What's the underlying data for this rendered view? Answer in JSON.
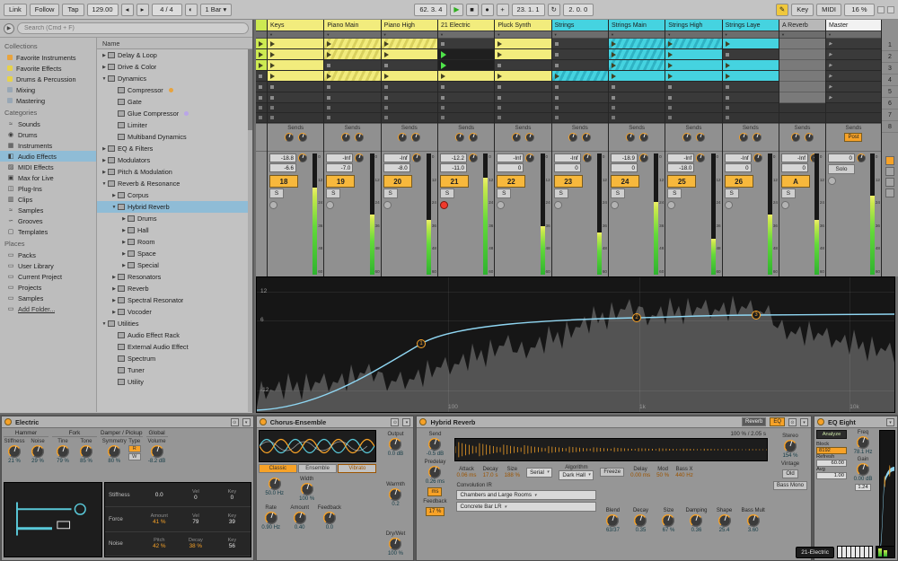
{
  "transport": {
    "link": "Link",
    "follow": "Follow",
    "tap": "Tap",
    "tempo": "129.00",
    "time_signature": "4 / 4",
    "quantization": "1 Bar",
    "arrangement_position": "62. 3. 4",
    "song_position": "23. 1. 1",
    "loop_length": "2. 0. 0",
    "key_button": "Key",
    "midi_button": "MIDI",
    "cpu_load": "16 %"
  },
  "browser": {
    "search_placeholder": "Search (Cmd + F)",
    "sections": {
      "collections": {
        "label": "Collections",
        "items": [
          {
            "label": "Favorite Instruments",
            "color": "#e8a33d"
          },
          {
            "label": "Favorite Effects",
            "color": "#e6d24b"
          },
          {
            "label": "Drums & Percussion",
            "color": "#e6d24b"
          },
          {
            "label": "Mixing",
            "color": "#98a7b5"
          },
          {
            "label": "Mastering",
            "color": "#98a7b5"
          }
        ]
      },
      "categories": {
        "label": "Categories",
        "items": [
          {
            "label": "Sounds",
            "icon": "waves"
          },
          {
            "label": "Drums",
            "icon": "drum"
          },
          {
            "label": "Instruments",
            "icon": "keys"
          },
          {
            "label": "Audio Effects",
            "icon": "fx",
            "selected": true
          },
          {
            "label": "MIDI Effects",
            "icon": "midi"
          },
          {
            "label": "Max for Live",
            "icon": "max"
          },
          {
            "label": "Plug-Ins",
            "icon": "plug"
          },
          {
            "label": "Clips",
            "icon": "clip"
          },
          {
            "label": "Samples",
            "icon": "sample"
          },
          {
            "label": "Grooves",
            "icon": "groove"
          },
          {
            "label": "Templates",
            "icon": "template"
          }
        ]
      },
      "places": {
        "label": "Places",
        "items": [
          {
            "label": "Packs"
          },
          {
            "label": "User Library"
          },
          {
            "label": "Current Project"
          },
          {
            "label": "Projects"
          },
          {
            "label": "Samples"
          },
          {
            "label": "Add Folder...",
            "underline": true
          }
        ]
      }
    },
    "tree_header": "Name",
    "tree": [
      {
        "label": "Delay & Loop",
        "depth": 0,
        "arrow": "right"
      },
      {
        "label": "Drive & Color",
        "depth": 0,
        "arrow": "right"
      },
      {
        "label": "Dynamics",
        "depth": 0,
        "arrow": "down"
      },
      {
        "label": "Compressor",
        "depth": 1,
        "arrow": "none",
        "dot": "#e8a33d"
      },
      {
        "label": "Gate",
        "depth": 1,
        "arrow": "none"
      },
      {
        "label": "Glue Compressor",
        "depth": 1,
        "arrow": "none",
        "dot": "#b9a5e8"
      },
      {
        "label": "Limiter",
        "depth": 1,
        "arrow": "none"
      },
      {
        "label": "Multiband Dynamics",
        "depth": 1,
        "arrow": "none"
      },
      {
        "label": "EQ & Filters",
        "depth": 0,
        "arrow": "right"
      },
      {
        "label": "Modulators",
        "depth": 0,
        "arrow": "right"
      },
      {
        "label": "Pitch & Modulation",
        "depth": 0,
        "arrow": "right"
      },
      {
        "label": "Reverb & Resonance",
        "depth": 0,
        "arrow": "down"
      },
      {
        "label": "Corpus",
        "depth": 1,
        "arrow": "right"
      },
      {
        "label": "Hybrid Reverb",
        "depth": 1,
        "arrow": "down",
        "selected": true
      },
      {
        "label": "Drums",
        "depth": 2,
        "arrow": "right"
      },
      {
        "label": "Hall",
        "depth": 2,
        "arrow": "right"
      },
      {
        "label": "Room",
        "depth": 2,
        "arrow": "right"
      },
      {
        "label": "Space",
        "depth": 2,
        "arrow": "right"
      },
      {
        "label": "Special",
        "depth": 2,
        "arrow": "right"
      },
      {
        "label": "Resonators",
        "depth": 1,
        "arrow": "right"
      },
      {
        "label": "Reverb",
        "depth": 1,
        "arrow": "right"
      },
      {
        "label": "Spectral Resonator",
        "depth": 1,
        "arrow": "right"
      },
      {
        "label": "Vocoder",
        "depth": 1,
        "arrow": "right"
      },
      {
        "label": "Utilities",
        "depth": 0,
        "arrow": "down"
      },
      {
        "label": "Audio Effect Rack",
        "depth": 1,
        "arrow": "none"
      },
      {
        "label": "External Audio Effect",
        "depth": 1,
        "arrow": "none"
      },
      {
        "label": "Spectrum",
        "depth": 1,
        "arrow": "none"
      },
      {
        "label": "Tuner",
        "depth": 1,
        "arrow": "none"
      },
      {
        "label": "Utility",
        "depth": 1,
        "arrow": "none"
      }
    ]
  },
  "session": {
    "sends_label": "Sends",
    "fader_scale": [
      "0",
      "12",
      "24",
      "36",
      "48",
      "60"
    ],
    "scene_numbers": [
      "1",
      "2",
      "3",
      "4",
      "5",
      "6",
      "7",
      "8"
    ],
    "tracks": [
      {
        "name": "",
        "color": "#cdea52",
        "narrow": true,
        "clips": [
          "l",
          "l",
          "l",
          "e",
          "e",
          "e"
        ],
        "mixer": {}
      },
      {
        "name": "Keys",
        "color": "#f2ec7d",
        "clips": [
          "y",
          "y",
          "y",
          "y",
          "e",
          "e"
        ],
        "mixer": {
          "peak": "-18.8",
          "vol": "-6.6",
          "num": "18",
          "meter": 0.72
        }
      },
      {
        "name": "Piano Main",
        "color": "#f2ec7d",
        "clips": [
          "yh",
          "yh",
          "e",
          "yh",
          "e",
          "e"
        ],
        "mixer": {
          "peak": "-Inf",
          "vol": "-7.0",
          "num": "19",
          "meter": 0.5
        }
      },
      {
        "name": "Piano High",
        "color": "#f2ec7d",
        "clips": [
          "yh",
          "y",
          "e",
          "y",
          "e",
          "e"
        ],
        "mixer": {
          "peak": "-Inf",
          "vol": "-8.0",
          "num": "20",
          "meter": 0.45
        }
      },
      {
        "name": "21 Electric",
        "color": "#f2ec7d",
        "clips": [
          "e",
          "p",
          "p",
          "y",
          "e",
          "e"
        ],
        "mixer": {
          "peak": "-12.2",
          "vol": "-11.0",
          "num": "21",
          "meter": 0.8,
          "armed": true
        }
      },
      {
        "name": "Pluck Synth",
        "color": "#f2ec7d",
        "clips": [
          "y",
          "y",
          "e",
          "y",
          "e",
          "e"
        ],
        "mixer": {
          "peak": "-Inf",
          "vol": "0",
          "num": "22",
          "meter": 0.4
        }
      },
      {
        "name": "Strings",
        "color": "#45d3e0",
        "clips": [
          "e",
          "e",
          "e",
          "ch",
          "e",
          "e"
        ],
        "mixer": {
          "peak": "-Inf",
          "vol": "0",
          "num": "23",
          "meter": 0.35
        }
      },
      {
        "name": "Strings Main",
        "color": "#45d3e0",
        "clips": [
          "ch",
          "ch",
          "ch",
          "c",
          "e",
          "e"
        ],
        "mixer": {
          "peak": "-18.9",
          "vol": "0",
          "num": "24",
          "meter": 0.6
        }
      },
      {
        "name": "Strings High",
        "color": "#45d3e0",
        "clips": [
          "ch",
          "c",
          "c",
          "c",
          "e",
          "e"
        ],
        "mixer": {
          "peak": "-Inf",
          "v ol": "",
          "vol": "-18.0",
          "num": "25",
          "meter": 0.3
        }
      },
      {
        "name": "Strings Laye",
        "color": "#45d3e0",
        "clips": [
          "c",
          "e",
          "c",
          "c",
          "e",
          "e"
        ],
        "mixer": {
          "peak": "-Inf",
          "vol": "0",
          "num": "26",
          "meter": 0.5
        }
      },
      {
        "name": "A Reverb",
        "color": "#b8b8b8",
        "kind": "return",
        "clips": [
          "x",
          "x",
          "x",
          "x",
          "x",
          "x"
        ],
        "mixer": {
          "peak": "-Inf",
          "vol": "0",
          "num": "A",
          "meter": 0.45
        }
      },
      {
        "name": "Master",
        "color": "#f2f2f2",
        "kind": "master",
        "clips": [
          "s",
          "s",
          "s",
          "s",
          "s",
          "s"
        ],
        "mixer": {
          "vol": "0",
          "solo": "Solo",
          "post": "Post",
          "meter": 0.65
        }
      }
    ]
  },
  "spectrum": {
    "db_labels": [
      "12",
      "6",
      "-12"
    ],
    "freq_labels": [
      "100",
      "1k",
      "10k"
    ],
    "handles": [
      "1",
      "2",
      "3"
    ]
  },
  "devices": {
    "electric": {
      "title": "Electric",
      "sections": [
        {
          "name": "Hammer",
          "params": [
            {
              "label": "Stiffness",
              "value": "21 %"
            },
            {
              "label": "Noise",
              "value": "29 %"
            }
          ]
        },
        {
          "name": "Fork",
          "params": [
            {
              "label": "Tine",
              "value": "79 %"
            },
            {
              "label": "Tone",
              "value": "85 %"
            }
          ]
        },
        {
          "name": "Damper / Pickup",
          "params": [
            {
              "label": "Symmetry",
              "value": "80 %"
            }
          ]
        },
        {
          "name": "Global",
          "params": [
            {
              "label": "Volume",
              "value": "-8.2 dB"
            }
          ]
        }
      ],
      "type": {
        "label": "Type",
        "options": [
          "R",
          "W"
        ],
        "selected": "R"
      },
      "table": [
        {
          "name": "Stiffness",
          "cells": [
            {
              "label": "",
              "value": "0.0"
            },
            {
              "label": "Vel",
              "value": "0"
            },
            {
              "label": "Key",
              "value": "0"
            }
          ]
        },
        {
          "name": "Force",
          "cells": [
            {
              "label": "Amount",
              "value": "41 %"
            },
            {
              "label": "Vel",
              "value": "79"
            },
            {
              "label": "Key",
              "value": "39"
            }
          ]
        },
        {
          "name": "Noise",
          "cells": [
            {
              "label": "Pitch",
              "value": "42 %"
            },
            {
              "label": "Decay",
              "value": "38 %"
            },
            {
              "label": "Key",
              "value": "56"
            }
          ]
        }
      ]
    },
    "chorus": {
      "title": "Chorus-Ensemble",
      "modes": [
        "Classic",
        "Ensemble",
        "Vibrato"
      ],
      "selected_mode": "Classic",
      "hpf": {
        "label": "",
        "value": "50.0 Hz"
      },
      "width": {
        "label": "Width",
        "value": "100 %"
      },
      "rate": {
        "label": "Rate",
        "value": "0.90 Hz"
      },
      "amount": {
        "label": "Amount",
        "value": "0.40"
      },
      "feedback": {
        "label": "Feedback",
        "value": "0.0"
      },
      "output": {
        "label": "Output",
        "value": "0.0 dB"
      },
      "warmth": {
        "label": "Warmth",
        "value": "0.2"
      },
      "drywet": {
        "label": "Dry/Wet",
        "value": "100 %"
      }
    },
    "hybrid_reverb": {
      "title": "Hybrid Reverb",
      "tabs": [
        "Reverb",
        "EQ"
      ],
      "selected_tab": "Reverb",
      "dry_wet_readout": "100 % / 2.05 s",
      "send": {
        "label": "Send",
        "value": "-0.5 dB"
      },
      "predelay": {
        "label": "Predelay",
        "value": "0.26 ms"
      },
      "ms_toggle": "ms",
      "feedback_label": "Feedback",
      "feedback_value": "17 %",
      "conv_params": [
        {
          "label": "Attack",
          "value": "0.06 ms"
        },
        {
          "label": "Decay",
          "value": "17.0 s"
        },
        {
          "label": "Size",
          "value": "188 %"
        }
      ],
      "routing": "Serial",
      "algorithm_label": "Algorithm",
      "algorithm": "Dark Hall",
      "freeze": "Freeze",
      "post_params": [
        {
          "label": "Delay",
          "value": "0.00 ms"
        },
        {
          "label": "Mod",
          "value": "50 %"
        },
        {
          "label": "Bass X",
          "value": "440 Hz"
        }
      ],
      "convolution_label": "Convolution IR",
      "ir_category": "Chambers and Large Rooms",
      "ir_file": "Concrete Bar LR",
      "knobs": [
        {
          "label": "Blend",
          "value": "63/37"
        },
        {
          "label": "Decay",
          "value": "0.35"
        },
        {
          "label": "Size",
          "value": "67 %"
        },
        {
          "label": "Damping",
          "value": "0.36"
        },
        {
          "label": "Shape",
          "value": "25.4"
        },
        {
          "label": "Bass Mult",
          "value": "3.60"
        }
      ],
      "stereo": {
        "label": "Stereo",
        "value": "154 %"
      },
      "vintage_label": "Vintage",
      "vintage_value": "Old",
      "bass_mono": "Bass Mono"
    },
    "eq_eight": {
      "title": "EQ Eight",
      "analyze": "Analyze",
      "rows": [
        {
          "label": "Block",
          "value": "8192",
          "style": "chip"
        },
        {
          "label": "Refresh",
          "value": "60.00",
          "style": "box"
        },
        {
          "label": "Avg",
          "value": "1.00",
          "style": "box"
        }
      ],
      "freq": {
        "label": "Freq",
        "value": "78.1 Hz"
      },
      "gain": {
        "label": "Gain",
        "value": "0.00 dB"
      },
      "q_value": "1.24"
    }
  },
  "status": {
    "track_indicator": "21-Electric"
  }
}
